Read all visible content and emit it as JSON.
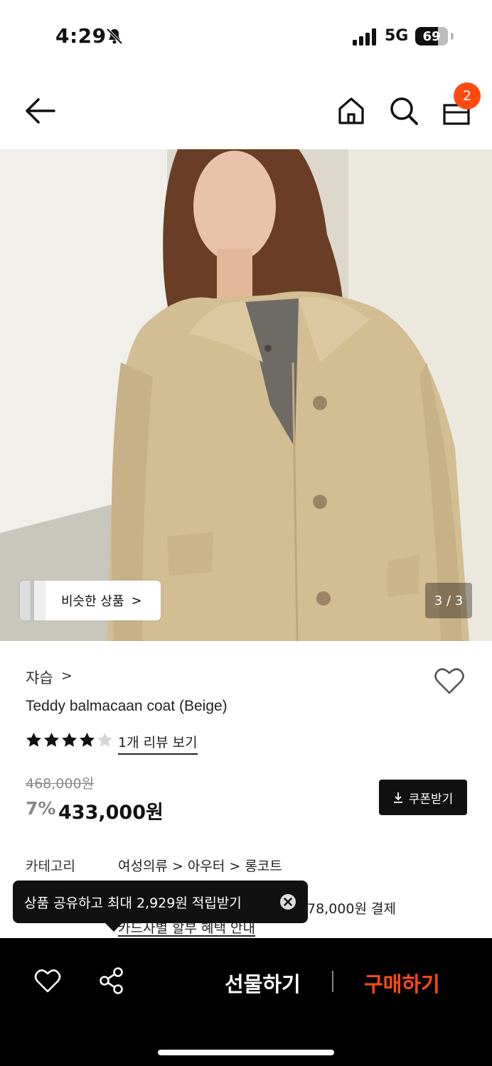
{
  "status_bar": {
    "time": "4:29",
    "network": "5G",
    "battery": "69"
  },
  "header": {
    "cart_count": "2"
  },
  "gallery": {
    "similar_label": "비슷한 상품",
    "similar_chevron": ">",
    "page_indicator": "3 / 3"
  },
  "product": {
    "brand": "쟈습",
    "brand_chevron": ">",
    "title": "Teddy balmacaan coat (Beige)",
    "rating": 4,
    "rating_max": 5,
    "reviews_link": "1개 리뷰 보기",
    "original_price": "468,000원",
    "discount": "7%",
    "price": "433,000원",
    "coupon_label": "쿠폰받기"
  },
  "details": {
    "category_label": "카테고리",
    "category_path": "여성의류 > 아우터 > 롱코트",
    "payment_tail": "78,000원 결제",
    "card_link": "카드사별 할부 혜택 안내"
  },
  "toast": {
    "text": "상품 공유하고 최대 2,929원 적립받기"
  },
  "bottom_bar": {
    "gift_label": "선물하기",
    "buy_label": "구매하기"
  },
  "colors": {
    "accent": "#ff4b12",
    "dark": "#111111",
    "coat": "#d2bc92"
  }
}
